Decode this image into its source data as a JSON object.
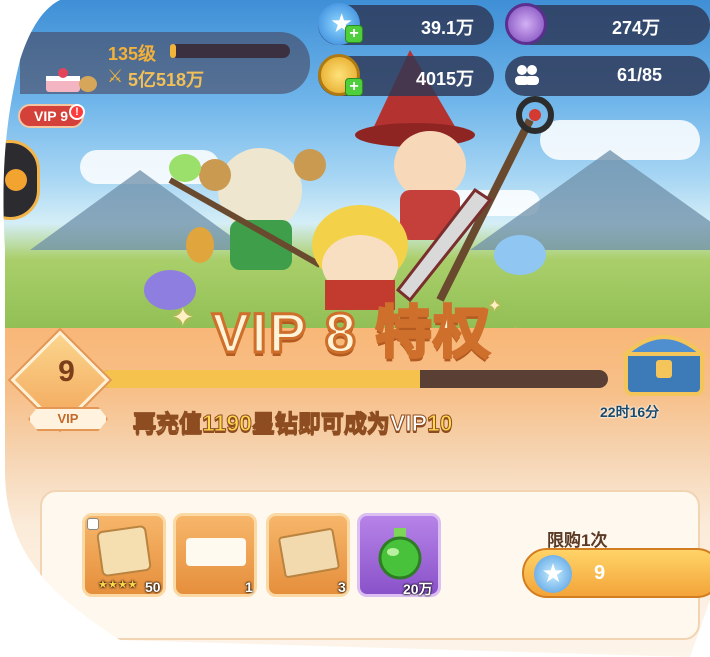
{
  "player": {
    "level": "135级",
    "level_progress": 0.05,
    "power": "5亿518万",
    "vip_badge": "VIP 9",
    "vip_alert": "!"
  },
  "resources": [
    {
      "name": "star-gem",
      "value": "39.1万",
      "icon": "blue-star-icon"
    },
    {
      "name": "purple-coin",
      "value": "274万",
      "icon": "purple-coin-icon"
    },
    {
      "name": "gold-coin",
      "value": "4015万",
      "icon": "gold-coin-icon"
    },
    {
      "name": "friends",
      "value": "61/85",
      "icon": "group-icon"
    }
  ],
  "banner": {
    "title": "VIP 8 特权"
  },
  "vip": {
    "current_level": "9",
    "tag": "VIP",
    "progress": 0.63,
    "recharge_prefix": "再充值",
    "recharge_amount": "1190",
    "recharge_middle": "星钻即可成为VIP",
    "recharge_target": "10"
  },
  "chest": {
    "timer": "22时16分"
  },
  "rewards": [
    {
      "icon": "scroll-card-icon",
      "count": "50",
      "stars": "★★★★"
    },
    {
      "icon": "coupon-icon",
      "count": "1"
    },
    {
      "icon": "ticket-icon",
      "count": "3"
    },
    {
      "icon": "green-potion-icon",
      "count": "20万"
    }
  ],
  "purchase": {
    "limit": "限购1次",
    "price": "9"
  },
  "colors": {
    "accent_orange": "#f2a65a",
    "title_stroke": "#cf6f2c",
    "progress": "#f5c24e",
    "vip_red": "#d3413a"
  }
}
